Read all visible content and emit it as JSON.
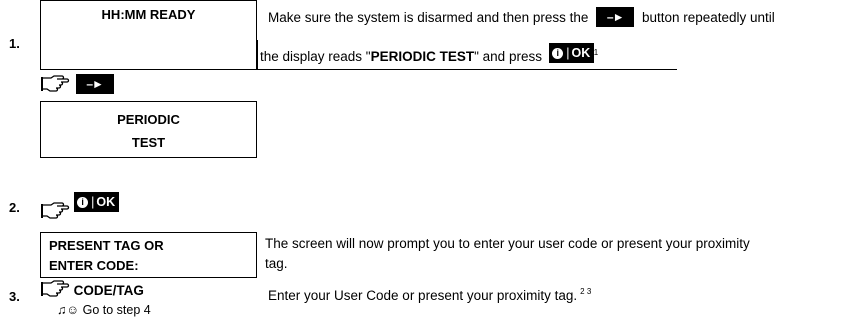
{
  "steps": [
    {
      "num": "1."
    },
    {
      "num": "2."
    },
    {
      "num": "3."
    }
  ],
  "step1": {
    "display": "HH:MM READY",
    "instr_part1": "Make sure the system is disarmed and then press the",
    "instr_part2": "button repeatedly until",
    "instr_part3": "the display reads \"",
    "instr_bold": "PERIODIC TEST",
    "instr_part4": "\" and press",
    "instr_sup": "1",
    "periodic_line1": "PERIODIC",
    "periodic_line2": "TEST"
  },
  "keys": {
    "arrow": "–►",
    "ok_info": "i",
    "ok_sep": "|",
    "ok_label": "OK"
  },
  "step2": {
    "display_line1": "PRESENT TAG OR",
    "display_line2": "ENTER CODE:",
    "instr_line1": "The screen will now prompt you to enter your user code or present your proximity",
    "instr_line2": "tag."
  },
  "step3": {
    "label": "CODE/TAG",
    "instr": "Enter your User Code or present your proximity tag.",
    "sup": "2 3",
    "goto": "♫☺ Go to step 4"
  },
  "icons": [
    "hand-pointing-icon",
    "arrow-key-icon",
    "info-ok-key-icon",
    "music-note-icon",
    "smiley-icon"
  ]
}
